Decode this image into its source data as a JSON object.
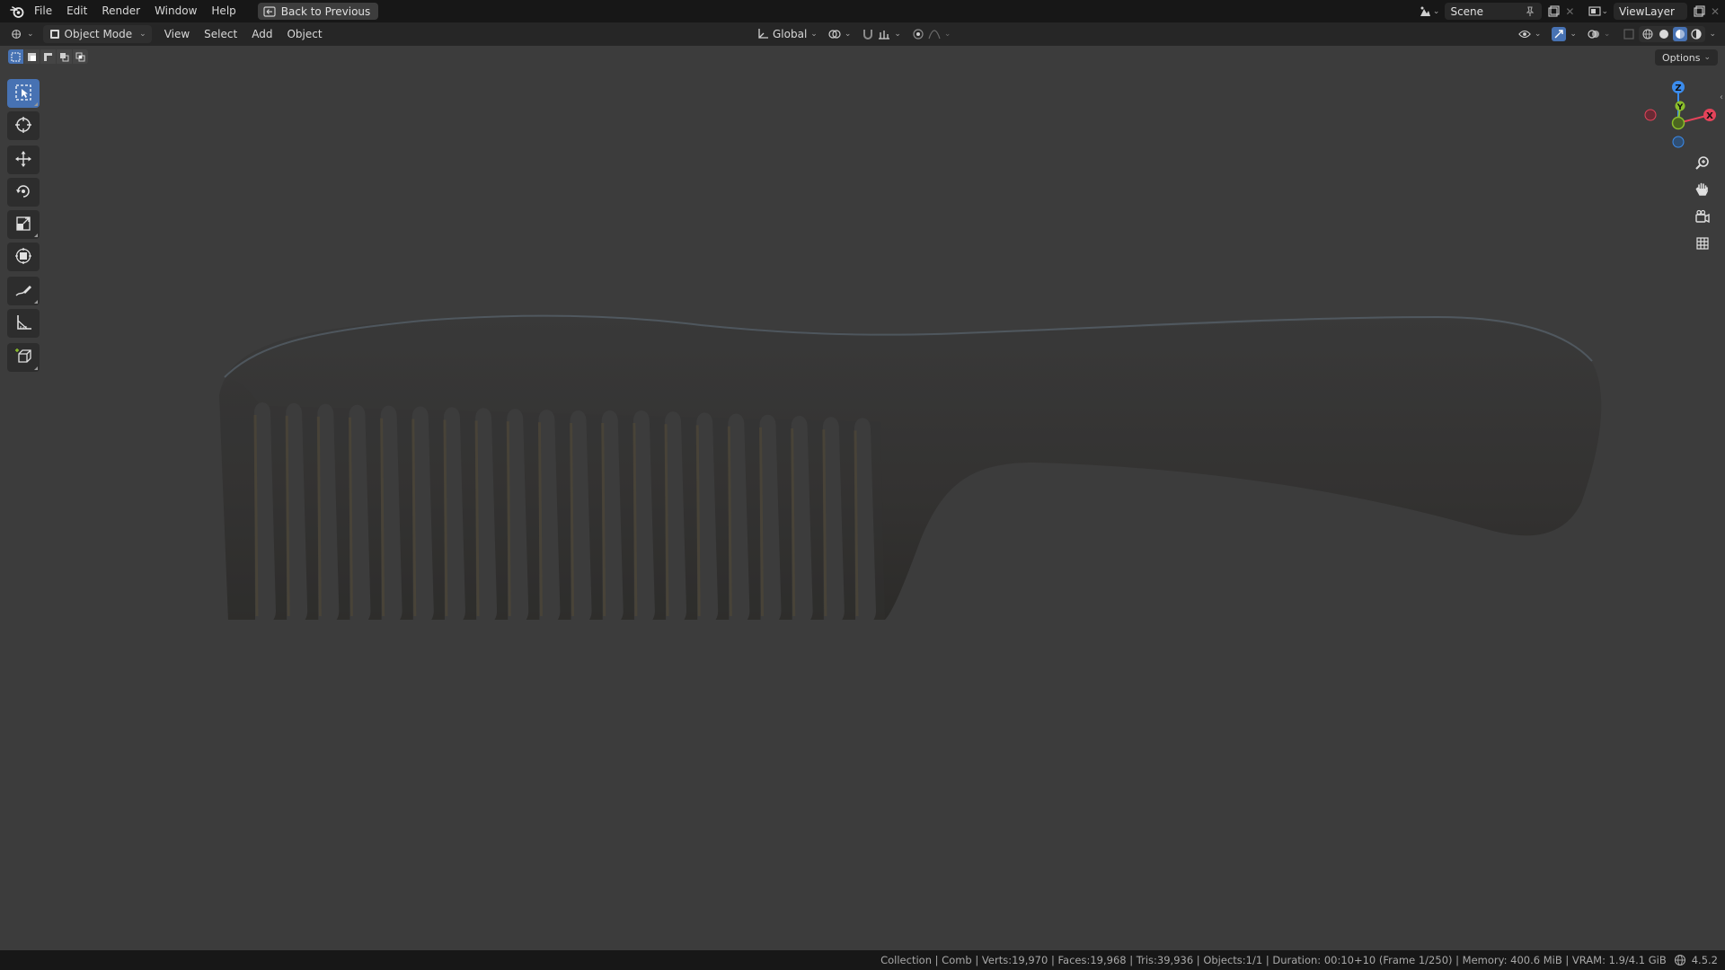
{
  "menubar": {
    "items": [
      "File",
      "Edit",
      "Render",
      "Window",
      "Help"
    ],
    "back_button": "Back to Previous",
    "scene": "Scene",
    "view_layer": "ViewLayer"
  },
  "viewport_header": {
    "mode": "Object Mode",
    "menus": [
      "View",
      "Select",
      "Add",
      "Object"
    ],
    "orientation": "Global",
    "options": "Options"
  },
  "selection_modes": [
    "set",
    "extend",
    "subtract",
    "invert",
    "intersect"
  ],
  "toolbar": {
    "tools": [
      {
        "name": "select-box",
        "icon": "select-box-icon",
        "active": true
      },
      {
        "name": "cursor",
        "icon": "cursor-icon",
        "active": false
      },
      {
        "name": "move",
        "icon": "move-icon",
        "active": false
      },
      {
        "name": "rotate",
        "icon": "rotate-icon",
        "active": false
      },
      {
        "name": "scale",
        "icon": "scale-icon",
        "active": false
      },
      {
        "name": "transform",
        "icon": "transform-icon",
        "active": false
      },
      {
        "name": "annotate",
        "icon": "annotate-icon",
        "active": false
      },
      {
        "name": "measure",
        "icon": "measure-icon",
        "active": false
      },
      {
        "name": "add-cube",
        "icon": "add-cube-icon",
        "active": false
      }
    ]
  },
  "gizmo": {
    "x": "X",
    "y": "Y",
    "z": "Z",
    "colors": {
      "x": "#e4435a",
      "y": "#8bbf2b",
      "z": "#3b8ced"
    }
  },
  "viewport": {
    "background": "#3c3c3c",
    "object": "Comb"
  },
  "statusbar": {
    "text": "Collection | Comb | Verts:19,970 | Faces:19,968 | Tris:39,936 | Objects:1/1 | Duration: 00:10+10 (Frame 1/250) | Memory: 400.6 MiB | VRAM: 1.9/4.1 GiB",
    "version": "4.5.2"
  },
  "colors": {
    "accent": "#4772b3",
    "topbar": "#171717",
    "header": "#262626"
  }
}
